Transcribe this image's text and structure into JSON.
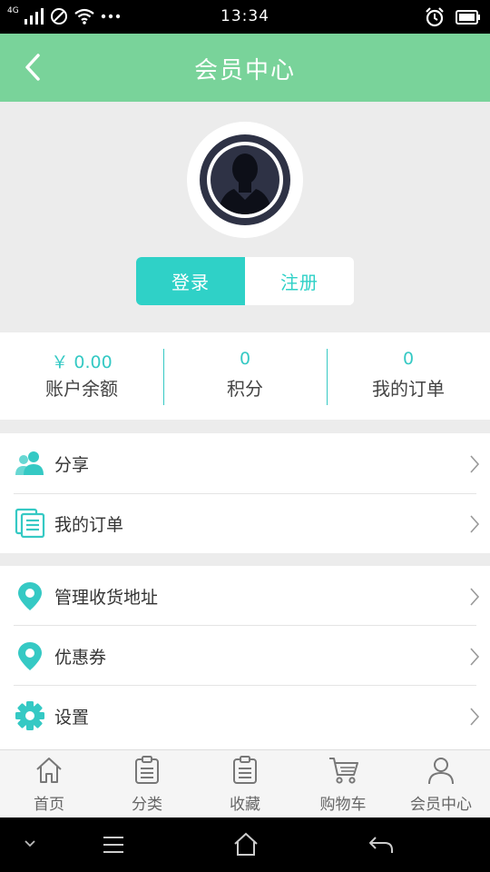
{
  "status_bar": {
    "network": "4G",
    "time": "13:34"
  },
  "header": {
    "title": "会员中心",
    "back_icon": "chevron-left-icon"
  },
  "auth": {
    "login_label": "登录",
    "register_label": "注册"
  },
  "stats": [
    {
      "value": "￥ 0.00",
      "label": "账户余额"
    },
    {
      "value": "0",
      "label": "积分"
    },
    {
      "value": "0",
      "label": "我的订单"
    }
  ],
  "menu": {
    "group1": [
      {
        "label": "分享",
        "icon": "users-icon"
      },
      {
        "label": "我的订单",
        "icon": "orders-icon"
      }
    ],
    "group2": [
      {
        "label": "管理收货地址",
        "icon": "location-pin-icon"
      },
      {
        "label": "优惠券",
        "icon": "location-pin-icon"
      },
      {
        "label": "设置",
        "icon": "gear-icon"
      }
    ]
  },
  "tabs": [
    {
      "label": "首页",
      "icon": "home-icon"
    },
    {
      "label": "分类",
      "icon": "clipboard-icon"
    },
    {
      "label": "收藏",
      "icon": "clipboard-icon"
    },
    {
      "label": "购物车",
      "icon": "cart-icon"
    },
    {
      "label": "会员中心",
      "icon": "person-icon"
    }
  ],
  "colors": {
    "header": "#79d39a",
    "accent": "#2fd1c7",
    "nav": "#000000"
  }
}
